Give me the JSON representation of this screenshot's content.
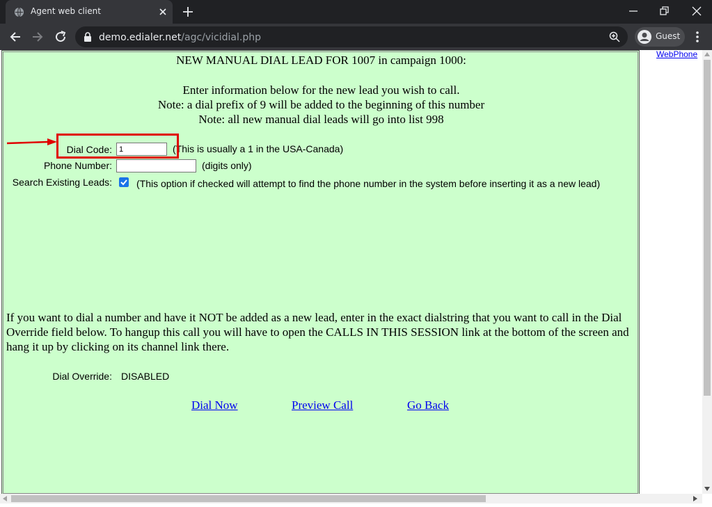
{
  "browser": {
    "tab_title": "Agent web client",
    "url_host": "demo.edialer.net",
    "url_path": "/agc/vicidial.php",
    "profile_label": "Guest"
  },
  "sidebar": {
    "webphone_link": "WebPhone "
  },
  "form": {
    "heading": "NEW MANUAL DIAL LEAD FOR 1007 in campaign 1000:",
    "intro_lines": [
      "Enter information below for the new lead you wish to call.",
      "Note: a dial prefix of 9 will be added to the beginning of this number",
      "Note: all new manual dial leads will go into list 998"
    ],
    "dial_code_label": "Dial Code:",
    "dial_code_value": "1",
    "dial_code_hint": "(This is usually a 1 in the USA-Canada)",
    "phone_label": "Phone Number:",
    "phone_value": "",
    "phone_hint": "(digits only)",
    "search_label": "Search Existing Leads:",
    "search_checked": true,
    "search_hint": "(This option if checked will attempt to find the phone number in the system before inserting it as a new lead)",
    "override_text": "If you want to dial a number and have it NOT be added as a new lead, enter in the exact dialstring that you want to call in the Dial Override field below. To hangup this call you will have to open the CALLS IN THIS SESSION link at the bottom of the screen and hang it up by clicking on its channel link there.",
    "override_label": "Dial Override:",
    "override_value": "DISABLED"
  },
  "actions": {
    "dial_now": "Dial Now",
    "preview_call": "Preview Call",
    "go_back": "Go Back"
  },
  "colors": {
    "panel_bg": "#ccffcc",
    "link": "#0000ee",
    "highlight": "#e00000",
    "checkbox": "#1a73e8",
    "chrome_dark": "#202124",
    "chrome_toolbar": "#35363a"
  }
}
